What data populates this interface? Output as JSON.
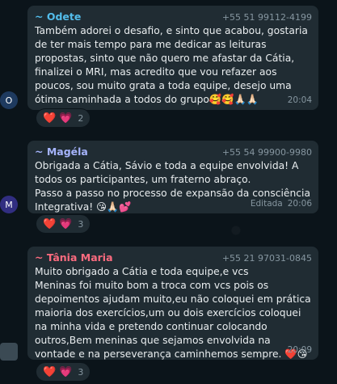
{
  "colors": {
    "odete": "#53bdeb",
    "magela": "#a5b4fc",
    "tania": "#fc6b7f",
    "bubble": "#202c33",
    "background": "#0b141a"
  },
  "messages": [
    {
      "sender": "~ Odete",
      "phone": "+55 51 99112-4199",
      "avatar": "O",
      "text": "Também adorei o desafio, e sinto que acabou, gostaria de ter mais tempo para me dedicar as leituras propostas, sinto que não quero me afastar da Cátia, finalizei o MRI, mas acredito que vou refazer aos poucos, sou muito grata a toda equipe, desejo uma ótima caminhada a todos do grupo🥰🥰🙏🏻🙏🏻",
      "time": "20:04",
      "edited": "",
      "reactions": [
        "❤️",
        "💗"
      ],
      "reaction_count": "2"
    },
    {
      "sender": "~ Magéla",
      "phone": "+55 54 99900-9980",
      "avatar": "M",
      "text": "Obrigada a Cátia, Sávio e toda a equipe envolvida! A todos os participantes, um fraterno abraço.\nPasso a passo no processo de expansão da consciência Integrativa! 😘🙏🏻💕",
      "time": "20:06",
      "edited": "Editada",
      "reactions": [
        "❤️",
        "💗"
      ],
      "reaction_count": "3"
    },
    {
      "sender": "~ Tânia Maria",
      "phone": "+55 21 97031-0845",
      "avatar": "",
      "text": "Muito obrigado a Cátia e toda equipe,e vcs\nMeninas foi muito bom a troca com vcs pois os depoimentos ajudam muito,eu não coloquei em prática maioria dos exercícios,um ou dois exercícios coloquei na minha vida e pretendo continuar colocando outros,Bem meninas que sejamos envolvida na vontade e na perseverança caminhemos sempre. ❤️😘",
      "time": "20:09",
      "edited": "",
      "reactions": [
        "❤️",
        "💗"
      ],
      "reaction_count": "3"
    }
  ]
}
